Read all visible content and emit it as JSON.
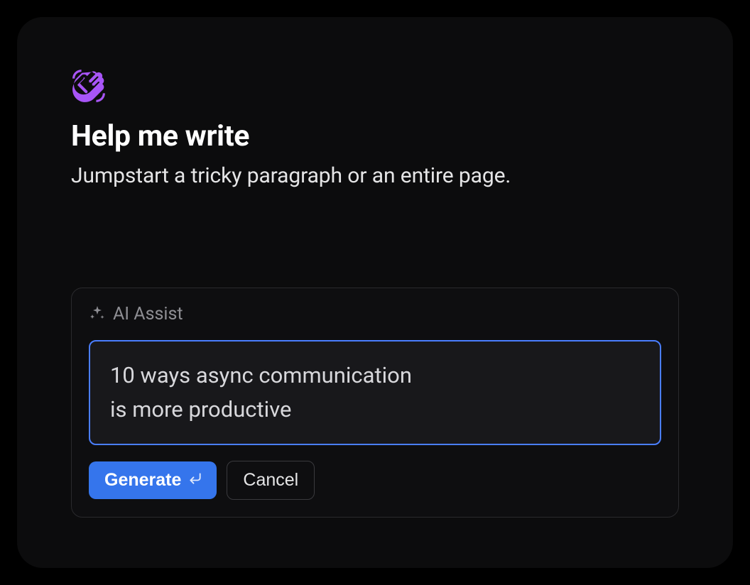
{
  "header": {
    "icon": "wave-hand",
    "title": "Help me write",
    "subtitle": "Jumpstart a tricky paragraph or an entire page."
  },
  "assist": {
    "label": "AI Assist",
    "prompt_value": "10 ways async communication\nis more productive",
    "buttons": {
      "generate": "Generate",
      "cancel": "Cancel"
    }
  },
  "colors": {
    "accent_purple": "#a855f7",
    "accent_blue": "#3575ec",
    "focus_ring": "#4a7eff"
  }
}
